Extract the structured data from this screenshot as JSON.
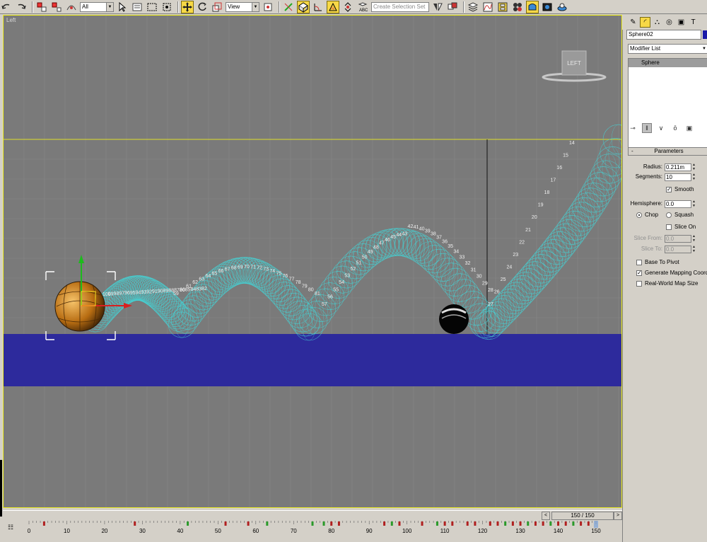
{
  "toolbar": {
    "selection_filter": "All",
    "coord_system": "View",
    "named_selection_placeholder": "Create Selection Set",
    "icons": [
      "undo-icon",
      "redo-icon",
      "link-icon",
      "unlink-icon",
      "bind-space-warp-icon",
      "select-icon",
      "select-by-name-icon",
      "rect-region-icon",
      "window-crossing-icon",
      "move-icon",
      "rotate-icon",
      "scale-icon",
      "pivot-icon",
      "select-manipulate-icon",
      "snap-icon",
      "angle-snap-icon",
      "percent-snap-icon",
      "spinner-snap-icon",
      "edit-named-sel-icon",
      "mirror-icon",
      "align-icon",
      "layer-manager-icon",
      "curve-editor-icon",
      "schematic-view-icon",
      "material-editor-icon",
      "render-setup-icon",
      "render-frame-icon",
      "quick-render-icon"
    ],
    "accent_color": "#f7d846"
  },
  "viewport": {
    "label": "Left",
    "background": "#7a7a7a",
    "border_color": "#eeee22",
    "viewcube_label": "LEFT",
    "ground_color": "#2d2a9c",
    "trail_color": "#45d3d6"
  },
  "trajectory": {
    "frames_up": [
      "14",
      "15",
      "16",
      "17",
      "18",
      "19",
      "20",
      "21",
      "22",
      "23",
      "24",
      "25",
      "26",
      "27"
    ],
    "frames_arc2": [
      "28",
      "29",
      "30",
      "31",
      "32",
      "33",
      "34",
      "35",
      "36",
      "37",
      "38",
      "39",
      "40",
      "41",
      "42",
      "43",
      "44",
      "45",
      "46",
      "47",
      "48",
      "49",
      "50",
      "51",
      "52",
      "53",
      "54",
      "55",
      "56",
      "57"
    ],
    "frames_arc1": [
      "59",
      "60",
      "61",
      "62",
      "63",
      "64",
      "65",
      "66",
      "67",
      "68",
      "69",
      "70",
      "71",
      "72",
      "73",
      "74",
      "75",
      "76",
      "77",
      "78",
      "79",
      "80",
      "81"
    ],
    "frames_tail": [
      "82",
      "83",
      "84",
      "85",
      "86",
      "87",
      "88",
      "89",
      "90",
      "91",
      "92",
      "93",
      "94",
      "95",
      "96",
      "97",
      "98",
      "99",
      "100"
    ]
  },
  "command_panel": {
    "object_name": "Sphere02",
    "object_color": "#1a1aa8",
    "modifier_list": "Modifier List",
    "stack_item": "Sphere",
    "stack_tool_icons": [
      "pin-stack-icon",
      "show-end-result-icon",
      "make-unique-icon",
      "remove-modifier-icon",
      "configure-sets-icon"
    ],
    "tab_icons": [
      "create-tab-icon",
      "modify-tab-icon",
      "hierarchy-tab-icon",
      "motion-tab-icon",
      "display-tab-icon",
      "utilities-tab-icon"
    ],
    "rollout_title": "Parameters",
    "rollout_toggle": "-",
    "params": {
      "radius_label": "Radius:",
      "radius_value": "0.211m",
      "segments_label": "Segments:",
      "segments_value": "10",
      "smooth_label": "Smooth",
      "smooth_checked": true,
      "hemisphere_label": "Hemisphere:",
      "hemisphere_value": "0.0",
      "chop_label": "Chop",
      "squash_label": "Squash",
      "slice_on_label": "Slice On",
      "slice_from_label": "Slice From:",
      "slice_from_value": "0.0",
      "slice_to_label": "Slice To:",
      "slice_to_value": "0.0",
      "base_to_pivot_label": "Base To Pivot",
      "gen_mapping_label": "Generate Mapping Coords.",
      "gen_mapping_checked": true,
      "real_world_label": "Real-World Map Size"
    }
  },
  "timeline": {
    "current_label": "150 / 150",
    "current_frame": 150,
    "total_frames": 150,
    "ticks": [
      "0",
      "10",
      "20",
      "30",
      "40",
      "50",
      "60",
      "70",
      "80",
      "90",
      "100",
      "110",
      "120",
      "130",
      "140",
      "150"
    ],
    "keys": [
      4,
      28,
      42,
      52,
      58,
      63,
      75,
      78,
      80,
      82,
      94,
      96,
      98,
      104,
      108,
      110,
      112,
      116,
      118,
      122,
      124,
      126,
      128,
      130,
      132,
      134,
      136,
      138,
      140,
      142,
      144,
      146,
      148
    ]
  }
}
